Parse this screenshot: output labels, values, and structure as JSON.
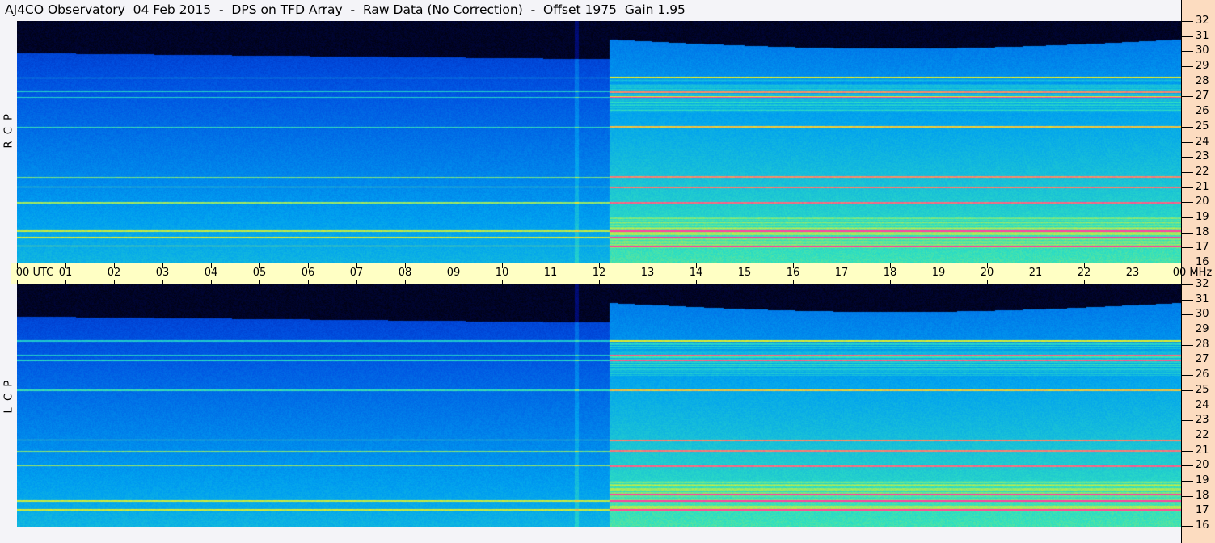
{
  "title": "AJ4CO Observatory  04 Feb 2015  -  DPS on TFD Array  -  Raw Data (No Correction)  -  Offset 1975  Gain 1.95",
  "chart_data": {
    "type": "heatmap",
    "title": "AJ4CO Observatory  04 Feb 2015  -  DPS on TFD Array  -  Raw Data (No Correction)  -  Offset 1975  Gain 1.95",
    "xlabel": "UTC",
    "ylabel": "MHz",
    "xlim": [
      0,
      24
    ],
    "ylim": [
      16,
      32
    ],
    "x_ticks": [
      "00 UTC",
      "01",
      "02",
      "03",
      "04",
      "05",
      "06",
      "07",
      "08",
      "09",
      "10",
      "11",
      "12",
      "13",
      "14",
      "15",
      "16",
      "17",
      "18",
      "19",
      "20",
      "21",
      "22",
      "23",
      "00 MHz"
    ],
    "y_ticks": [
      "32",
      "31",
      "30",
      "29",
      "28",
      "27",
      "26",
      "25",
      "24",
      "23",
      "22",
      "21",
      "20",
      "19",
      "18",
      "17",
      "16"
    ],
    "panels": [
      {
        "name": "RCP",
        "label": "R  C  P"
      },
      {
        "name": "LCP",
        "label": "L  C  P"
      }
    ],
    "daybreak_utc": 12.2,
    "interference_lines_mhz": [
      17.1,
      17.7,
      18.1,
      20.0,
      21.0,
      21.7,
      25.0,
      27.0,
      27.3,
      28.3
    ],
    "colormap": [
      "#000000",
      "#0010a0",
      "#0050e0",
      "#00a0f0",
      "#30e0c0",
      "#f0f020",
      "#ff40a0"
    ]
  }
}
